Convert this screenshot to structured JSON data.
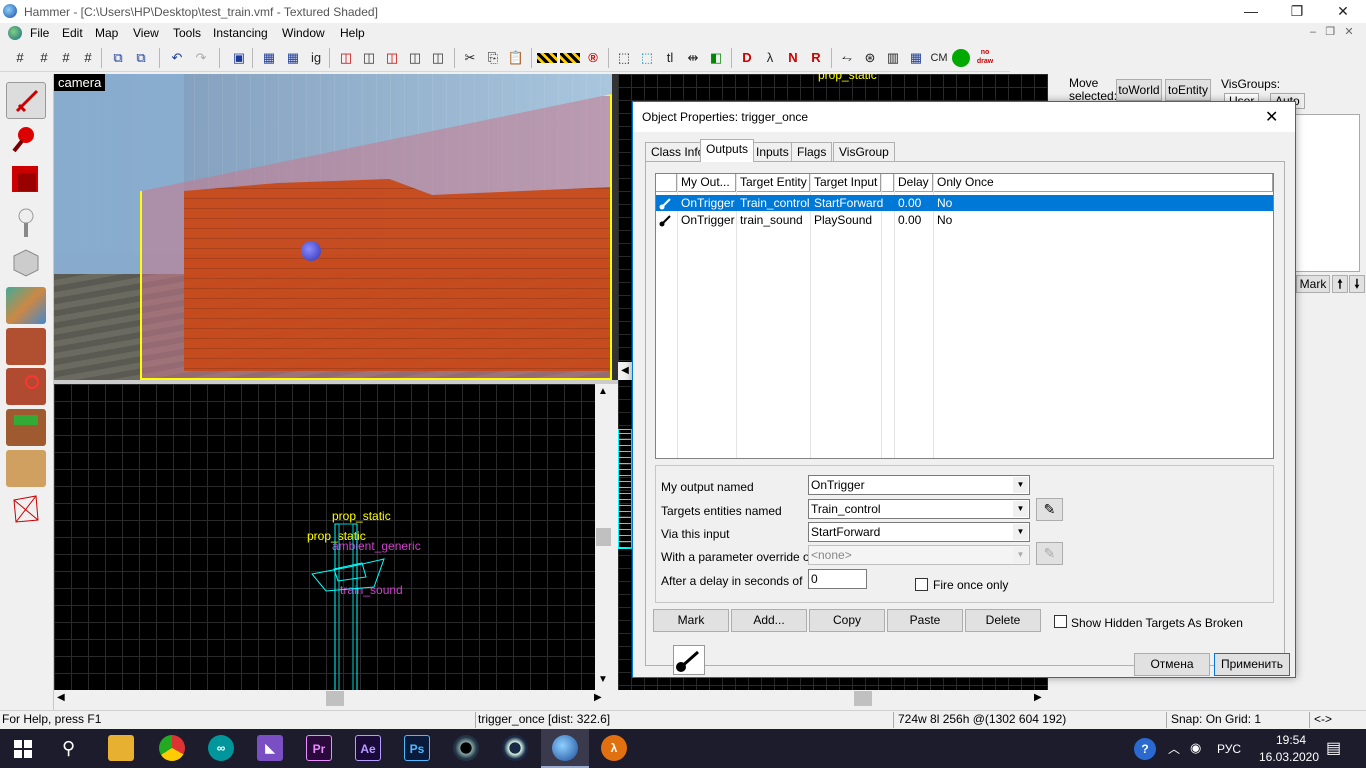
{
  "window": {
    "title": "Hammer - [C:\\Users\\HP\\Desktop\\test_train.vmf - Textured Shaded]",
    "minimize": "—",
    "restore": "❐",
    "close": "✕"
  },
  "menu": [
    "File",
    "Edit",
    "Map",
    "View",
    "Tools",
    "Instancing",
    "Window",
    "Help"
  ],
  "toolbar": {
    "items": [
      "grid-icon",
      "grid-smaller-icon",
      "grid-larger-icon",
      "grid-toggle-icon",
      "group-icon",
      "ungroup-icon",
      "undo-icon",
      "redo-icon",
      "load-window-icon",
      "save-window-icon",
      "ig",
      "hide-icon",
      "unhide-icon",
      "camera-icon",
      "cut-icon",
      "copy-icon",
      "paste-icon",
      "carve-icon",
      "clip-icon",
      "texture-lock-icon",
      "tl",
      "tl-scale",
      "run-map-icon"
    ],
    "text_items": [
      "ig",
      "tl",
      "CM"
    ],
    "nodraw_label": "no\ndraw"
  },
  "viewports": {
    "camera_label": "camera",
    "top_labels": [
      "prop_static",
      "prop_static",
      "ambient_generic",
      "train_sound"
    ],
    "right_label": "prop_static"
  },
  "side_panel": {
    "move_label": "Move\nselected:",
    "to_world": "toWorld",
    "to_entity": "toEntity",
    "visgroups_label": "VisGroups:",
    "user_tab": "User",
    "auto_tab": "Auto",
    "mark_btn": "Mark",
    "up_btn": "🠕",
    "down_btn": "🠗"
  },
  "dialog": {
    "title": "Object Properties: trigger_once",
    "tabs": [
      "Class Info",
      "Outputs",
      "Inputs",
      "Flags",
      "VisGroup"
    ],
    "active_tab": "Outputs",
    "columns": [
      "My Out...",
      "Target Entity",
      "Target Input",
      "",
      "Delay",
      "Only Once"
    ],
    "rows": [
      {
        "output": "OnTrigger",
        "target": "Train_control",
        "input": "StartForward",
        "delay": "0.00",
        "once": "No"
      },
      {
        "output": "OnTrigger",
        "target": "train_sound",
        "input": "PlaySound",
        "delay": "0.00",
        "once": "No"
      }
    ],
    "selected_row": 0,
    "fields": {
      "output_label": "My output named",
      "output_value": "OnTrigger",
      "targets_label": "Targets entities named",
      "targets_value": "Train_control",
      "input_label": "Via this input",
      "input_value": "StartForward",
      "param_label": "With a parameter override of",
      "param_value": "<none>",
      "delay_label": "After a delay in seconds of",
      "delay_value": "0",
      "fire_once_label": "Fire once only"
    },
    "buttons": {
      "mark": "Mark",
      "add": "Add...",
      "copy": "Copy",
      "paste": "Paste",
      "delete": "Delete",
      "show_hidden": "Show Hidden Targets As Broken",
      "cancel": "Отмена",
      "apply": "Применить"
    }
  },
  "status": {
    "help": "For Help, press F1",
    "selection": "trigger_once  [dist: 322.6]",
    "size": "724w 8l 256h @(1302 604 192)",
    "snap": "Snap: On Grid: 1",
    "extra": "<->"
  },
  "taskbar": {
    "lang": "РУС",
    "time": "19:54",
    "date": "16.03.2020",
    "apps": [
      "file-explorer-icon",
      "chrome-icon",
      "arduino-icon",
      "visual-studio-icon",
      "Pr",
      "Ae",
      "Ps",
      "cinema4d-icon",
      "steam-icon",
      "hammer-icon",
      "half-life-icon"
    ]
  }
}
